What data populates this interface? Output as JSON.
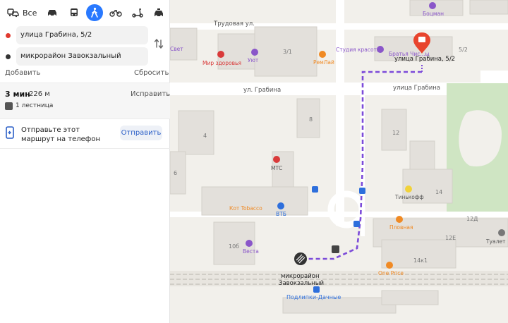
{
  "modes": {
    "all_label": "Все",
    "items": [
      "car-icon",
      "bus-icon",
      "walk-icon",
      "bicycle-icon",
      "scooter-icon",
      "taxi-icon"
    ],
    "active": "walk-icon"
  },
  "route": {
    "from": "улица Грабина, 5/2",
    "to": "микрорайон Завокзальный",
    "add_label": "Добавить",
    "reset_label": "Сбросить",
    "time": "3 мин",
    "distance": "226 м",
    "fix_label": "Исправить",
    "stairs": "1 лестница"
  },
  "send": {
    "text": "Отправьте этот маршрут на телефон",
    "button": "Отправить"
  },
  "map": {
    "streets": {
      "trudovaya": "Трудовая ул.",
      "grabina_left": "ул. Грабина",
      "grabina_right": "улица Грабина"
    },
    "poi": {
      "bocman": "Боцман",
      "svet": "Свет",
      "mir": "Мир здоровья",
      "uyut": "Уют",
      "bld31": "3/1",
      "rk": "РемЛай",
      "studio": "Студия красоты",
      "brothers": "Братья Чис...ы",
      "bld52": "5/2",
      "dest": "улица Грабина, 5/2",
      "bld8": "8",
      "bld4": "4",
      "bld12": "12",
      "bld6": "6",
      "mts": "МТС",
      "tinkoff": "Тинькофф",
      "bld14": "14",
      "kot": "Кот Tobacco",
      "vtb": "ВТБ",
      "bld12d": "12Д",
      "plovnaya": "Пловная",
      "bld12e": "12Е",
      "toilet": "Туалет",
      "bld10b": "10б",
      "vesta": "Веста",
      "bld14a": "14к1",
      "oneprice": "One Price",
      "origin1": "микрорайон",
      "origin2": "Завокзальный",
      "station": "Подлипки-Дачные"
    },
    "colors": {
      "route": "#7c4bd9",
      "dest_pin": "#e8442d",
      "poi_purple": "#8a56c9",
      "poi_orange": "#f08a24",
      "poi_blue": "#2e6fdc",
      "poi_red": "#d93a3a"
    }
  }
}
